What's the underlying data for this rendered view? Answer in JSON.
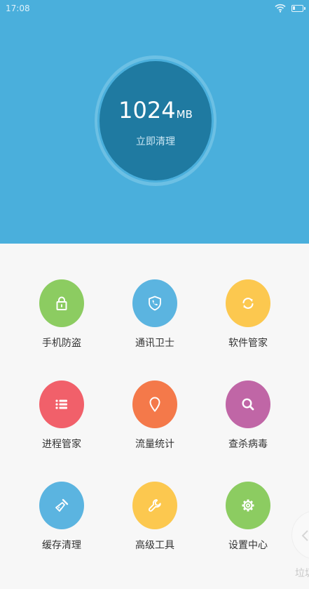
{
  "status_bar": {
    "time": "17:08"
  },
  "memory": {
    "value": "1024",
    "unit": "MB",
    "action_label": "立即清理"
  },
  "grid": [
    {
      "label": "手机防盗",
      "icon": "lock-icon",
      "color": "#8ccc61"
    },
    {
      "label": "通讯卫士",
      "icon": "phone-shield-icon",
      "color": "#5bb4e0"
    },
    {
      "label": "软件管家",
      "icon": "refresh-icon",
      "color": "#fcc84f"
    },
    {
      "label": "进程管家",
      "icon": "list-icon",
      "color": "#f1606a"
    },
    {
      "label": "流量统计",
      "icon": "location-pin-icon",
      "color": "#f4794a"
    },
    {
      "label": "查杀病毒",
      "icon": "search-icon",
      "color": "#c066a6"
    },
    {
      "label": "缓存清理",
      "icon": "broom-icon",
      "color": "#5bb4e0"
    },
    {
      "label": "高级工具",
      "icon": "wrench-icon",
      "color": "#fcc84f"
    },
    {
      "label": "设置中心",
      "icon": "gear-icon",
      "color": "#8ccc61"
    }
  ],
  "edge_drawer": {
    "label": "垃圾"
  }
}
